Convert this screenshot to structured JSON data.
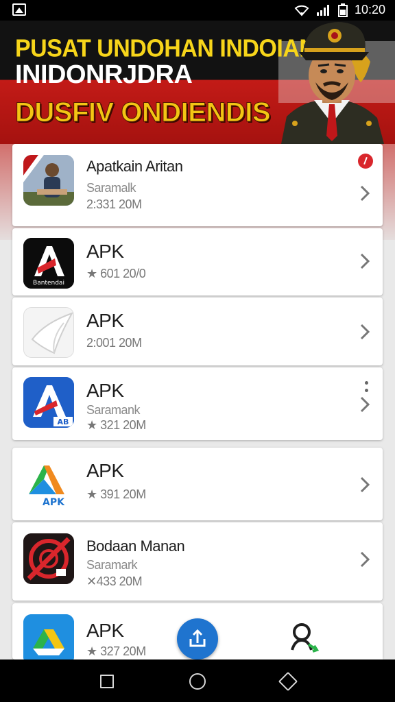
{
  "status_bar": {
    "time": "10:20"
  },
  "banner": {
    "line1": "PUSAT UNDOHAN INDOIAN",
    "line2": "INIDONRJDRA",
    "line3": "DUSFIV ONDIENDIS"
  },
  "apps": [
    {
      "title": "Apatkain Aritan",
      "subtitle": "Saramalk",
      "meta": "2:331 20M",
      "icon": "photo-icon",
      "badge": true
    },
    {
      "title": "APK",
      "subtitle": "",
      "meta": "★ 601 20/0",
      "icon": "letter-a-icon",
      "icon_caption": "Bantendai"
    },
    {
      "title": "APK",
      "subtitle": "",
      "meta": "2:001 20M",
      "icon": "paper-icon"
    },
    {
      "title": "APK",
      "subtitle": "Saramank",
      "meta": "★ 321 20M",
      "icon": "letter-a-blue-icon",
      "icon_caption": "AB",
      "more_menu": true
    },
    {
      "title": "APK",
      "subtitle": "",
      "meta": "★ 391 20M",
      "icon": "apk-logo-icon",
      "icon_caption": "APK"
    },
    {
      "title": "Bodaan Manan",
      "subtitle": "Saramark",
      "meta": "✕433 20M",
      "icon": "no-signal-icon"
    },
    {
      "title": "APK",
      "subtitle": "",
      "meta": "★ 327 20M",
      "icon": "drive-icon"
    }
  ],
  "colors": {
    "banner_yellow": "#f7d51a",
    "banner_red": "#c31b17",
    "fab_blue": "#1f74cf",
    "badge_red": "#d9262c"
  }
}
